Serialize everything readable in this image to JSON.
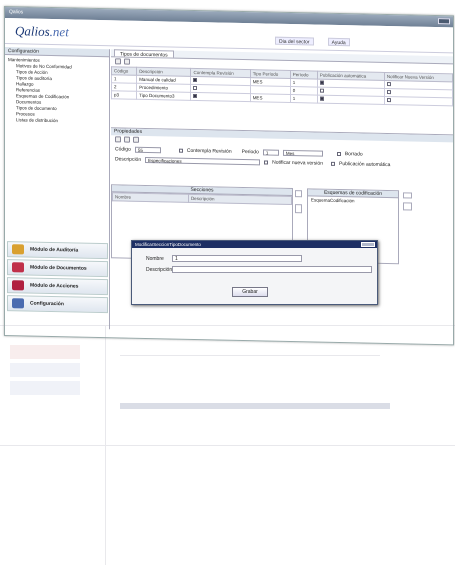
{
  "app": {
    "title": "Qalios",
    "logo_main": "Qalios",
    "logo_suffix": ".net"
  },
  "topnav": [
    "Dia del sector",
    "Ayuda"
  ],
  "sidebar": {
    "title": "Configuración",
    "tree": [
      {
        "label": "Mantenimientos",
        "sub": false
      },
      {
        "label": "Motivos de No Conformidad",
        "sub": true
      },
      {
        "label": "Tipos de Acción",
        "sub": true
      },
      {
        "label": "Tipos de auditoría",
        "sub": true
      },
      {
        "label": "Hallazgo",
        "sub": true
      },
      {
        "label": "Referencias",
        "sub": true
      },
      {
        "label": "Esquemas de Codificación",
        "sub": true
      },
      {
        "label": "Documentos",
        "sub": true
      },
      {
        "label": "Tipos de documento",
        "sub": true
      },
      {
        "label": "Procesos",
        "sub": true
      },
      {
        "label": "Listas de distribución",
        "sub": true
      }
    ],
    "modules": [
      {
        "label": "Módulo de Auditoría",
        "color": "#d9a030"
      },
      {
        "label": "Módulo de Documentos",
        "color": "#c0304a"
      },
      {
        "label": "Módulo de Acciones",
        "color": "#b02040"
      },
      {
        "label": "Configuración",
        "color": "#4a6bb0"
      }
    ]
  },
  "main": {
    "tab": "Tipos de documentos",
    "grid": {
      "headers": [
        "Código",
        "Descripción",
        "Contempla Revisión",
        "Tipo Período",
        "Período",
        "Publicación automática",
        "Notificar Nueva Versión"
      ],
      "rows": [
        {
          "code": "1",
          "desc": "Manual de calidad",
          "rev": true,
          "tipo": "MES",
          "per": "1",
          "pub": true,
          "not": false
        },
        {
          "code": "2",
          "desc": "Procedimiento",
          "rev": false,
          "tipo": "",
          "per": "0",
          "pub": false,
          "not": false
        },
        {
          "code": "p3",
          "desc": "Tipo Documento3",
          "rev": true,
          "tipo": "MES",
          "per": "1",
          "pub": true,
          "not": false
        }
      ]
    },
    "props": {
      "title": "Propiedades",
      "codigo_label": "Código",
      "codigo": "55",
      "contempla_label": "Contempla Revisión",
      "periodo_label": "Periodo",
      "periodo": "1",
      "tipo": "Mes",
      "borrado_label": "Borrado",
      "descripcion_label": "Descripción",
      "descripcion": "Especificaciones",
      "notificar_label": "Notificar nueva versión",
      "publicacion_label": "Publicación automática",
      "secciones_title": "Secciones",
      "col_nombre": "Nombre",
      "col_descripcion": "Descripción",
      "esquemas_title": "Esquemas de codificación",
      "esquema_item": "EsquemaCodificación"
    }
  },
  "dialog": {
    "title": "ModificarSeccionTipoDocumento",
    "nombre_label": "Nombre",
    "nombre": "1",
    "descripcion_label": "Descripción",
    "descripcion": "",
    "save": "Grabar"
  }
}
